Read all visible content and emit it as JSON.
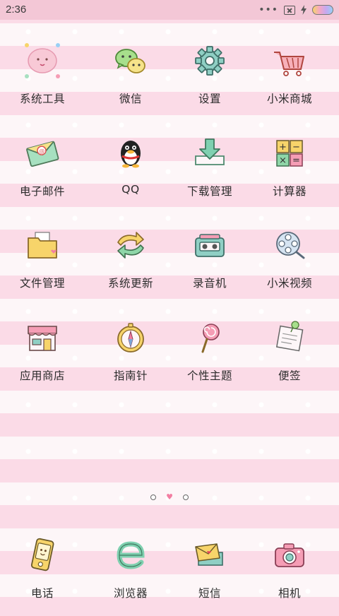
{
  "status_bar": {
    "time": "2:36",
    "icons": [
      "more-dots-icon",
      "no-sim-icon",
      "charging-bolt-icon",
      "battery-icon"
    ]
  },
  "home_grid": [
    [
      {
        "label": "系统工具",
        "icon": "folder-tools-icon"
      },
      {
        "label": "微信",
        "icon": "wechat-icon"
      },
      {
        "label": "设置",
        "icon": "gear-icon"
      },
      {
        "label": "小米商城",
        "icon": "shopping-cart-icon"
      }
    ],
    [
      {
        "label": "电子邮件",
        "icon": "envelope-icon"
      },
      {
        "label": "QQ",
        "icon": "penguin-icon"
      },
      {
        "label": "下载管理",
        "icon": "download-tray-icon"
      },
      {
        "label": "计算器",
        "icon": "calculator-icon"
      }
    ],
    [
      {
        "label": "文件管理",
        "icon": "folder-icon"
      },
      {
        "label": "系统更新",
        "icon": "refresh-arrows-icon"
      },
      {
        "label": "录音机",
        "icon": "cassette-recorder-icon"
      },
      {
        "label": "小米视频",
        "icon": "film-reel-icon"
      }
    ],
    [
      {
        "label": "应用商店",
        "icon": "shop-front-icon"
      },
      {
        "label": "指南针",
        "icon": "compass-icon"
      },
      {
        "label": "个性主题",
        "icon": "lollipop-icon"
      },
      {
        "label": "便签",
        "icon": "pinned-note-icon"
      }
    ]
  ],
  "page_indicator": {
    "pages": 3,
    "current": 2
  },
  "dock": [
    {
      "label": "电话",
      "icon": "phone-icon"
    },
    {
      "label": "浏览器",
      "icon": "browser-e-icon"
    },
    {
      "label": "短信",
      "icon": "message-envelope-icon"
    },
    {
      "label": "相机",
      "icon": "camera-icon"
    }
  ],
  "colors": {
    "stripe_pink": "#fbdbe7",
    "stripe_white": "#fdf6f8",
    "status_bar": "#f3c7d6",
    "accent_pink": "#f27ea2"
  }
}
